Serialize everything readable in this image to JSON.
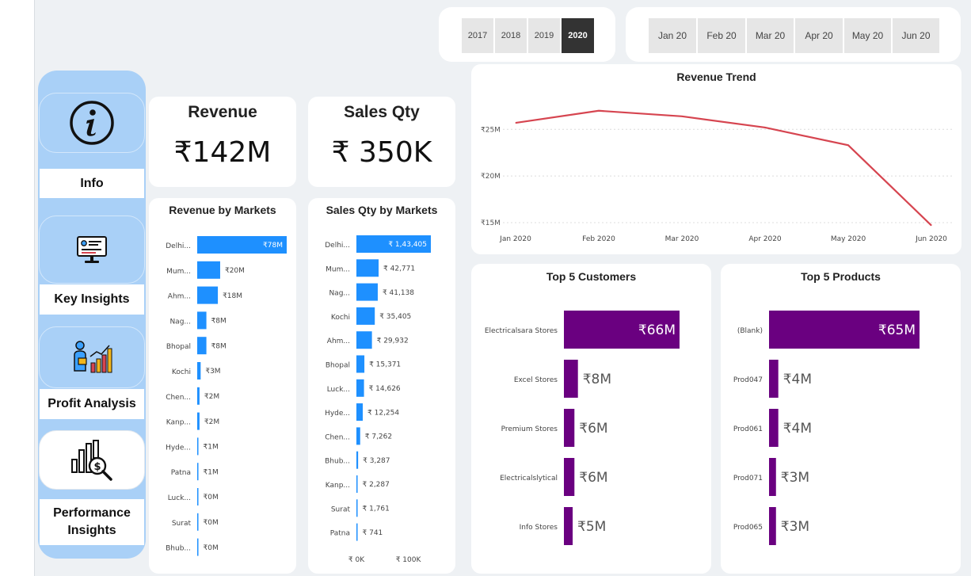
{
  "nav": {
    "items": [
      {
        "label": "Info",
        "icon": "info-icon"
      },
      {
        "label": "Key Insights",
        "icon": "presentation-screen-icon"
      },
      {
        "label": "Profit Analysis",
        "icon": "analyst-chart-icon"
      },
      {
        "label": "Performance Insights",
        "icon": "money-search-icon"
      }
    ]
  },
  "slicers": {
    "years": [
      "2017",
      "2018",
      "2019",
      "2020"
    ],
    "selected_year": "2020",
    "months": [
      "Jan 20",
      "Feb 20",
      "Mar 20",
      "Apr 20",
      "May 20",
      "Jun 20"
    ]
  },
  "kpis": {
    "revenue": {
      "title": "Revenue",
      "value": "₹142M"
    },
    "sales_qty": {
      "title": "Sales Qty",
      "value": "₹ 350K"
    }
  },
  "colors": {
    "blue_bar": "#1e90ff",
    "purple_bar": "#6a0080",
    "trend_line": "#d64550"
  },
  "chart_data": [
    {
      "id": "revenue_by_markets",
      "type": "bar",
      "orientation": "horizontal",
      "title": "Revenue by Markets",
      "categories": [
        "Delhi...",
        "Mum...",
        "Ahm...",
        "Nag...",
        "Bhopal",
        "Kochi",
        "Chen...",
        "Kanp...",
        "Hyde...",
        "Patna",
        "Luck...",
        "Surat",
        "Bhub..."
      ],
      "values": [
        78,
        20,
        18,
        8,
        8,
        3,
        2,
        2,
        1,
        1,
        0.3,
        0.2,
        0.1
      ],
      "labels": [
        "₹78M",
        "₹20M",
        "₹18M",
        "₹8M",
        "₹8M",
        "₹3M",
        "₹2M",
        "₹2M",
        "₹1M",
        "₹1M",
        "₹0M",
        "₹0M",
        "₹0M"
      ]
    },
    {
      "id": "sales_qty_by_markets",
      "type": "bar",
      "orientation": "horizontal",
      "title": "Sales Qty by Markets",
      "categories": [
        "Delhi...",
        "Mum...",
        "Nag...",
        "Kochi",
        "Ahm...",
        "Bhopal",
        "Luck...",
        "Hyde...",
        "Chen...",
        "Bhub...",
        "Kanp...",
        "Surat",
        "Patna"
      ],
      "values": [
        143405,
        42771,
        41138,
        35405,
        29932,
        15371,
        14626,
        12254,
        7262,
        3287,
        2287,
        1761,
        741
      ],
      "labels": [
        "₹ 1,43,405",
        "₹ 42,771",
        "₹ 41,138",
        "₹ 35,405",
        "₹ 29,932",
        "₹ 15,371",
        "₹ 14,626",
        "₹ 12,254",
        "₹ 7,262",
        "₹ 3,287",
        "₹ 2,287",
        "₹ 1,761",
        "₹ 741"
      ],
      "xticks": [
        "₹ 0K",
        "₹ 100K"
      ],
      "xlim": [
        0,
        150000
      ]
    },
    {
      "id": "revenue_trend",
      "type": "line",
      "title": "Revenue Trend",
      "x": [
        "Jan 2020",
        "Feb 2020",
        "Mar 2020",
        "Apr 2020",
        "May 2020",
        "Jun 2020"
      ],
      "values": [
        25.7,
        27.0,
        26.4,
        25.2,
        23.3,
        14.7
      ],
      "yticks": [
        "₹15M",
        "₹20M",
        "₹25M"
      ],
      "ytick_values": [
        15,
        20,
        25
      ],
      "ylim": [
        15,
        28
      ]
    },
    {
      "id": "top5_customers",
      "type": "bar",
      "orientation": "horizontal",
      "title": "Top 5 Customers",
      "categories": [
        "Electricalsara Stores",
        "Excel Stores",
        "Premium Stores",
        "Electricalslytical",
        "Info Stores"
      ],
      "values": [
        66,
        8,
        6,
        6,
        5
      ],
      "labels": [
        "₹66M",
        "₹8M",
        "₹6M",
        "₹6M",
        "₹5M"
      ]
    },
    {
      "id": "top5_products",
      "type": "bar",
      "orientation": "horizontal",
      "title": "Top 5 Products",
      "categories": [
        "(Blank)",
        "Prod047",
        "Prod061",
        "Prod071",
        "Prod065"
      ],
      "values": [
        65,
        4,
        4,
        3,
        3
      ],
      "labels": [
        "₹65M",
        "₹4M",
        "₹4M",
        "₹3M",
        "₹3M"
      ]
    }
  ]
}
